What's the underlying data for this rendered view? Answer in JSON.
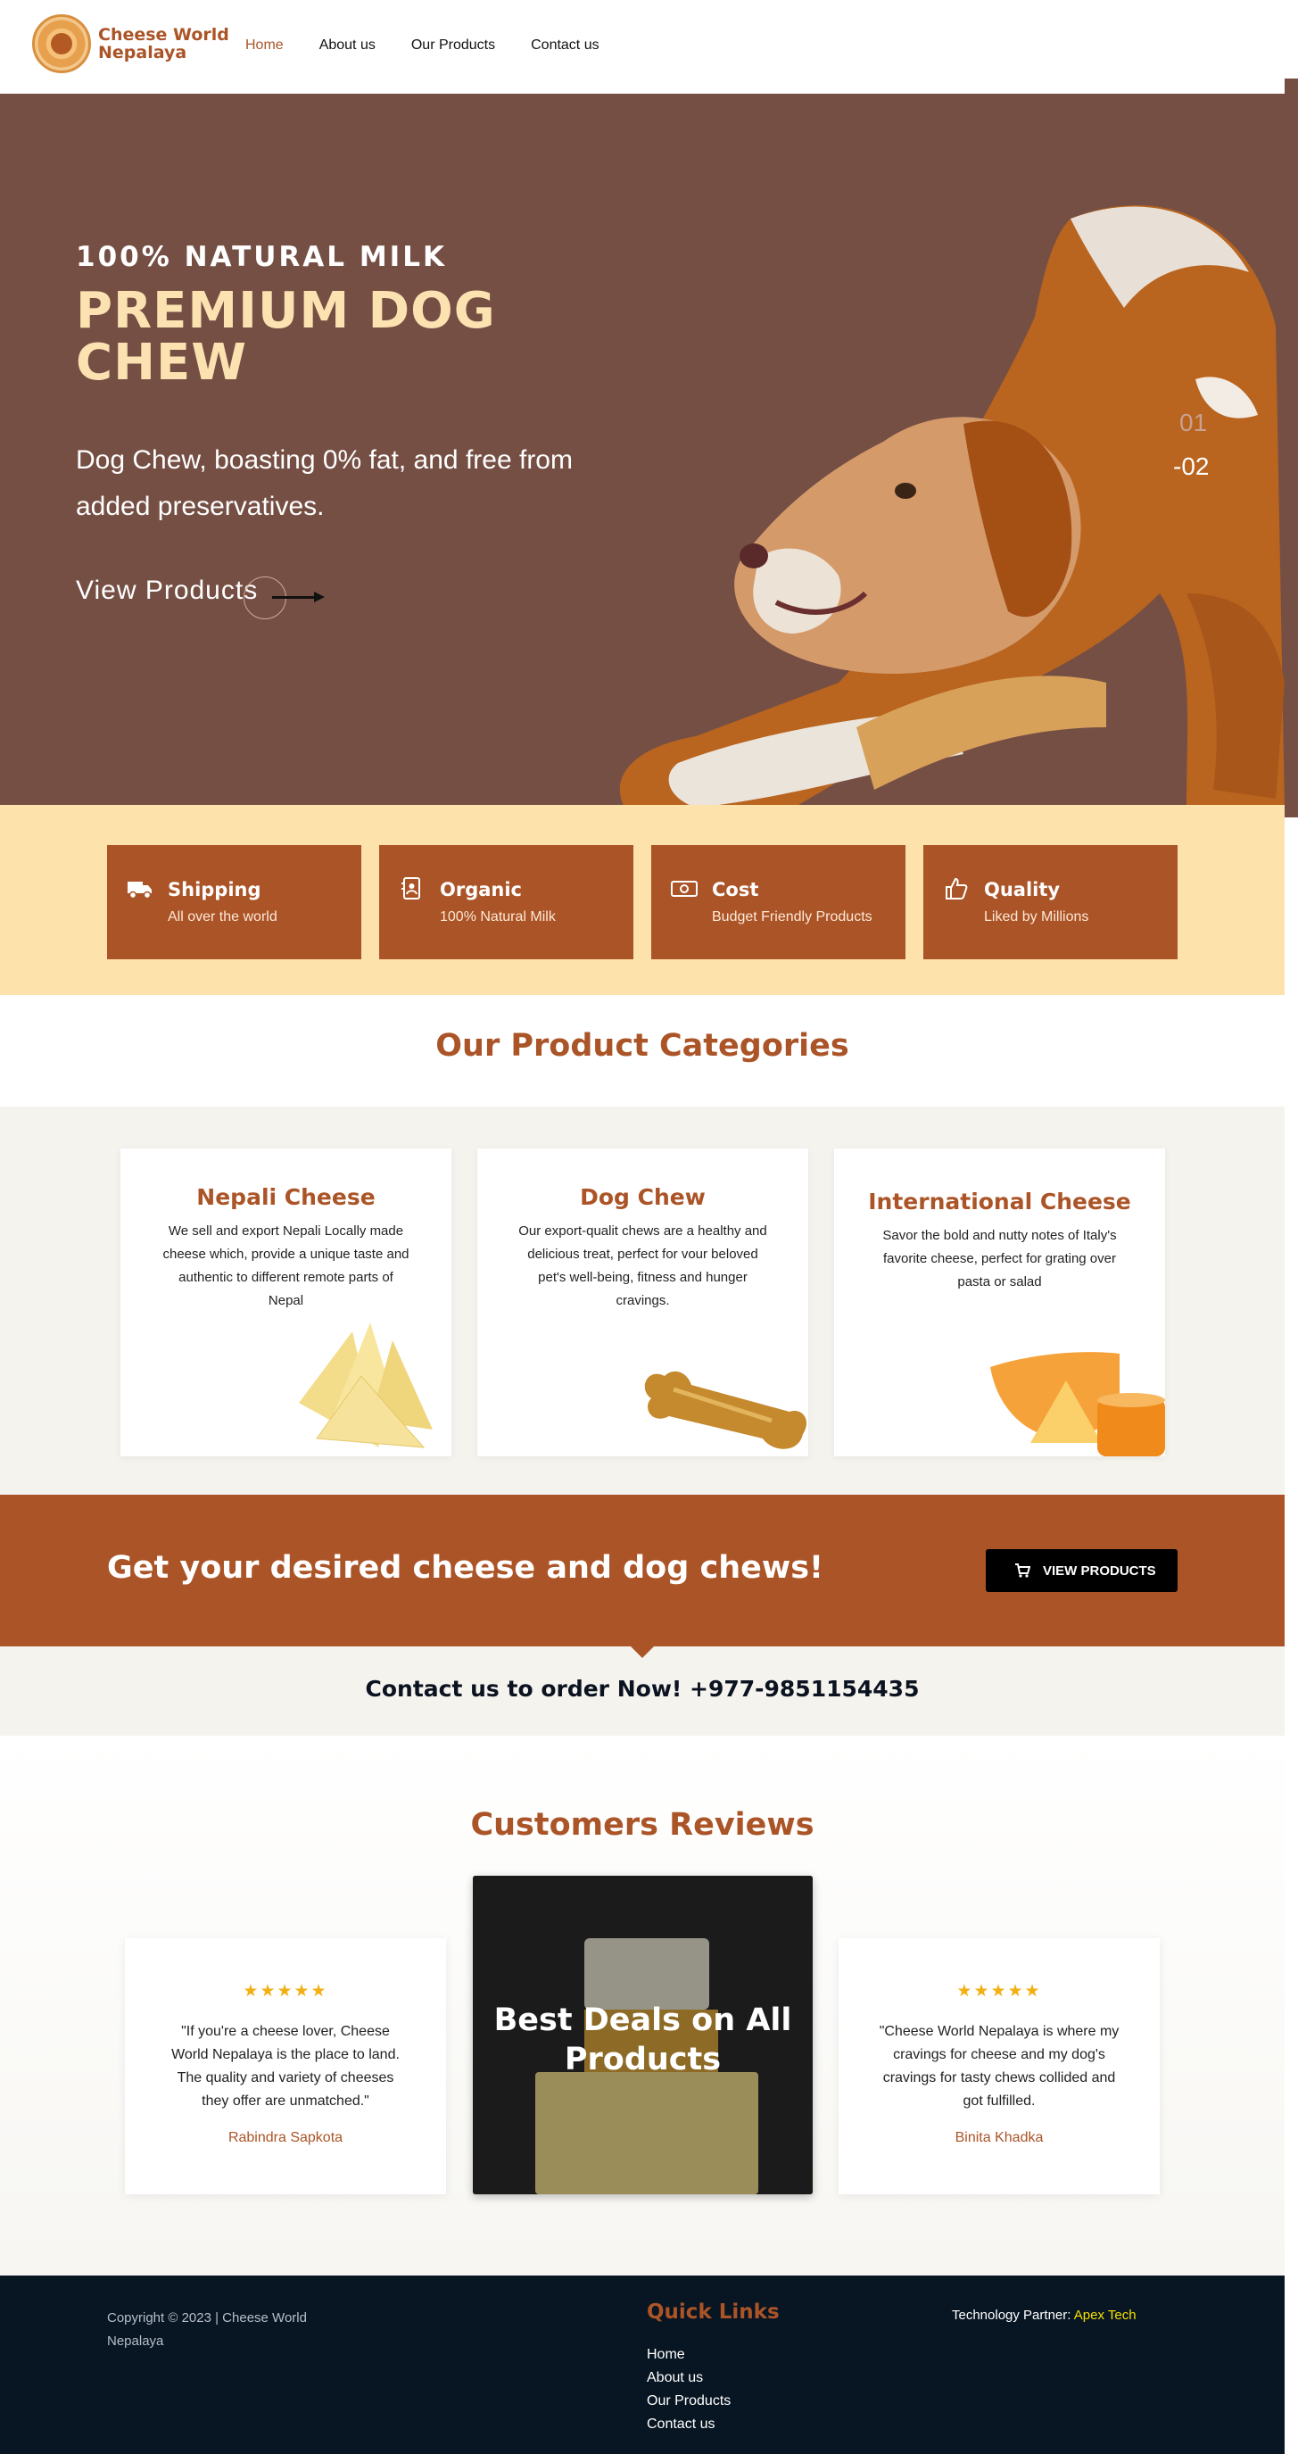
{
  "brand": {
    "name_line1": "Cheese World",
    "name_line2": "Nepalaya"
  },
  "nav": {
    "items": [
      "Home",
      "About us",
      "Our Products",
      "Contact us"
    ],
    "active": "Home"
  },
  "hero": {
    "kicker": "100% NATURAL MILK",
    "title": "PREMIUM DOG CHEW",
    "description": "Dog Chew, boasting 0% fat, and free from added preservatives.",
    "cta": "View Products",
    "slides": [
      "01",
      "-02"
    ]
  },
  "features": [
    {
      "icon": "truck-icon",
      "title": "Shipping",
      "subtitle": "All over the world"
    },
    {
      "icon": "contact-card-icon",
      "title": "Organic",
      "subtitle": "100% Natural Milk"
    },
    {
      "icon": "money-icon",
      "title": "Cost",
      "subtitle": "Budget Friendly Products"
    },
    {
      "icon": "thumbs-up-icon",
      "title": "Quality",
      "subtitle": "Liked by Millions"
    }
  ],
  "categories": {
    "heading": "Our Product Categories",
    "items": [
      {
        "title": "Nepali Cheese",
        "description": "We sell and export Nepali Locally made cheese which, provide a unique taste and authentic to different remote parts of Nepal"
      },
      {
        "title": "Dog Chew",
        "description": "Our export-qualit chews are a healthy and delicious treat, perfect for vour beloved pet's well-being, fitness and hunger cravings."
      },
      {
        "title": "International Cheese",
        "description": "Savor the bold and nutty notes of Italy's favorite cheese, perfect for grating over pasta or salad"
      }
    ]
  },
  "cta_band": {
    "title": "Get your desired cheese and dog chews!",
    "button": "VIEW PRODUCTS"
  },
  "contact": {
    "text": "Contact us to order Now! +977-9851154435"
  },
  "reviews": {
    "heading": "Customers Reviews",
    "items": [
      {
        "stars": "★★★★★",
        "rating": 4.5,
        "quote": "\"If you're a cheese lover, Cheese World Nepalaya is the place to land. The quality and variety of cheeses they offer are unmatched.\"",
        "author": "Rabindra Sapkota"
      },
      {
        "stars": "★★★★★",
        "rating": 5,
        "quote": "\"Cheese World Nepalaya is where my cravings for cheese and my dog's cravings for tasty chews collided and got fulfilled.",
        "author": "Binita Khadka"
      }
    ],
    "deal": "Best Deals on All Products"
  },
  "footer": {
    "copyright": "Copyright © 2023 | Cheese World Nepalaya",
    "quick_links_title": "Quick Links",
    "quick_links": [
      "Home",
      "About us",
      "Our Products",
      "Contact us"
    ],
    "partner_label": "Technology Partner:",
    "partner_name": "Apex Tech"
  },
  "colors": {
    "brand": "#ab5427",
    "hero_bg": "#754f44",
    "hero_title": "#fce1b1",
    "features_bg": "#fde2ab",
    "footer_bg": "#081623",
    "star": "#f2b015",
    "partner_link": "#f5e000"
  }
}
